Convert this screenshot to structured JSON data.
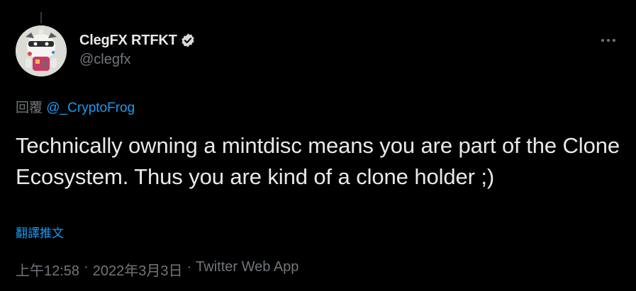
{
  "tweet": {
    "author": {
      "display_name": "ClegFX RTFKT",
      "handle": "@clegfx",
      "verified_icon": "verified-badge-icon"
    },
    "more_icon": "more-options-icon",
    "reply_prefix": "回覆",
    "reply_mention": "@_CryptoFrog",
    "text": "Technically owning a mintdisc means you are part of the Clone Ecosystem. Thus you are kind of a clone holder ;)",
    "translate_label": "翻譯推文",
    "time": "上午12:58",
    "separator": "·",
    "date": "2022年3月3日",
    "source": "Twitter Web App"
  },
  "colors": {
    "background": "#000000",
    "primary_text": "#e7e9ea",
    "secondary_text": "#71767b",
    "link": "#1d9bf0"
  }
}
